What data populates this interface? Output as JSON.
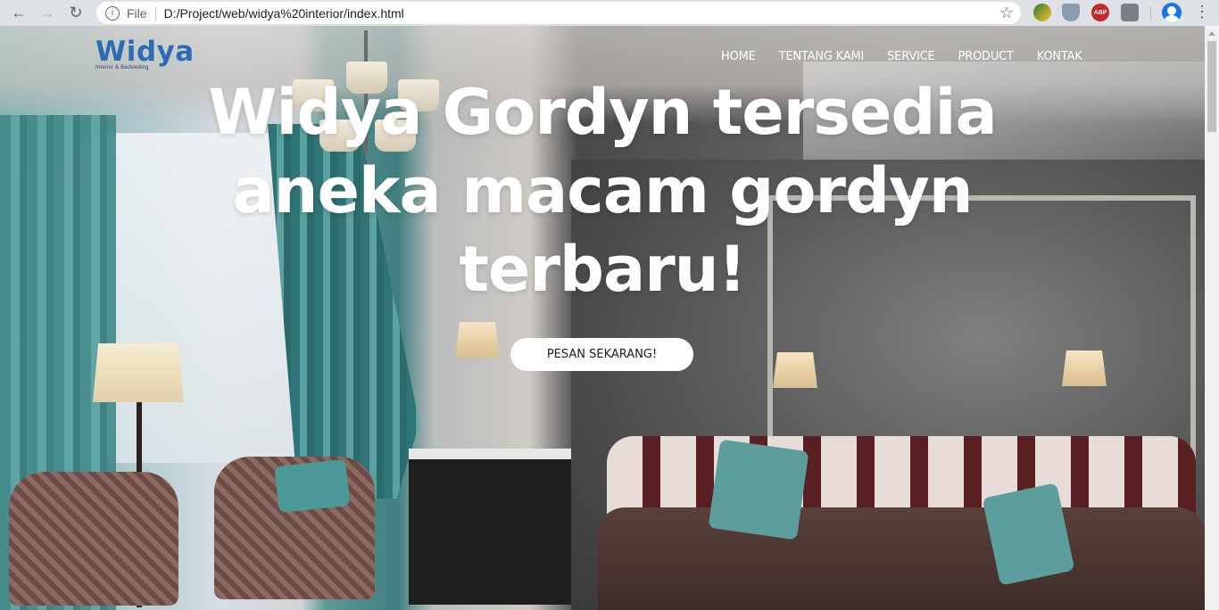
{
  "browser": {
    "back_icon": "←",
    "forward_icon": "→",
    "reload_icon": "↻",
    "scheme_label": "File",
    "url": "D:/Project/web/widya%20interior/index.html",
    "info_icon": "i",
    "star_icon": "☆",
    "ext_abp": "ABP",
    "menu_icon": "⋮"
  },
  "site": {
    "logo": "Widya",
    "logo_tagline": "Interior & Backleding",
    "nav": [
      "HOME",
      "TENTANG KAMI",
      "SERVICE",
      "PRODUCT",
      "KONTAK"
    ],
    "hero_lines": [
      "Widya Gordyn tersedia",
      "aneka macam gordyn",
      "terbaru!"
    ],
    "cta": "PESAN SEKARANG!"
  },
  "colors": {
    "logo": "#2e6bb5",
    "hero_text": "#ffffff",
    "cta_bg": "#ffffff"
  }
}
